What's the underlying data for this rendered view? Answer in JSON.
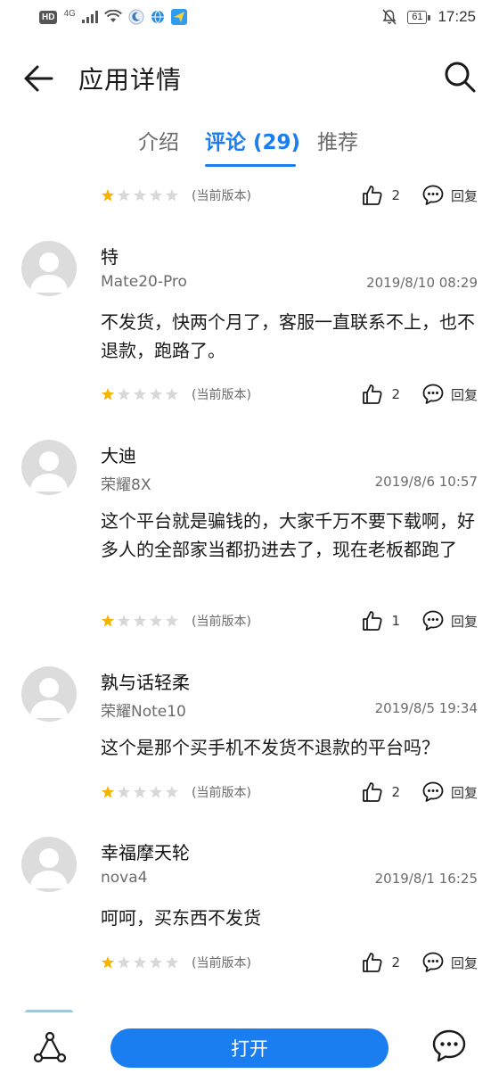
{
  "status_bar": {
    "hd": "HD",
    "network": "4G",
    "battery": "61",
    "time": "17:25"
  },
  "header": {
    "title": "应用详情"
  },
  "tabs": [
    {
      "label": "介绍",
      "active": false
    },
    {
      "label": "评论 (29)",
      "active": true
    },
    {
      "label": "推荐",
      "active": false
    }
  ],
  "top_partial": {
    "stars": 1,
    "version": "(当前版本)",
    "likes": "2",
    "reply": "回复"
  },
  "reviews": [
    {
      "name": "特",
      "device": "Mate20-Pro",
      "time": "2019/8/10 08:29",
      "content": "不发货，快两个月了，客服一直联系不上，也不退款，跑路了。",
      "stars": 1,
      "version": "(当前版本)",
      "likes": "2",
      "reply": "回复"
    },
    {
      "name": "大迪",
      "device": "荣耀8X",
      "time": "2019/8/6 10:57",
      "content": "这个平台就是骗钱的，大家千万不要下载啊，好多人的全部家当都扔进去了，现在老板都跑了",
      "stars": 1,
      "version": "(当前版本)",
      "likes": "1",
      "reply": "回复"
    },
    {
      "name": "孰与话轻柔",
      "device": "荣耀Note10",
      "time": "2019/8/5 19:34",
      "content": "这个是那个买手机不发货不退款的平台吗？",
      "stars": 1,
      "version": "(当前版本)",
      "likes": "2",
      "reply": "回复"
    },
    {
      "name": "幸福摩天轮",
      "device": "nova4",
      "time": "2019/8/1 16:25",
      "content": "呵呵，买东西不发货",
      "stars": 1,
      "version": "(当前版本)",
      "likes": "2",
      "reply": "回复"
    }
  ],
  "bottom_bar": {
    "open_label": "打开"
  },
  "colors": {
    "accent": "#1a7df0",
    "star_filled": "#f5b400",
    "star_empty": "#d8d8d8"
  }
}
